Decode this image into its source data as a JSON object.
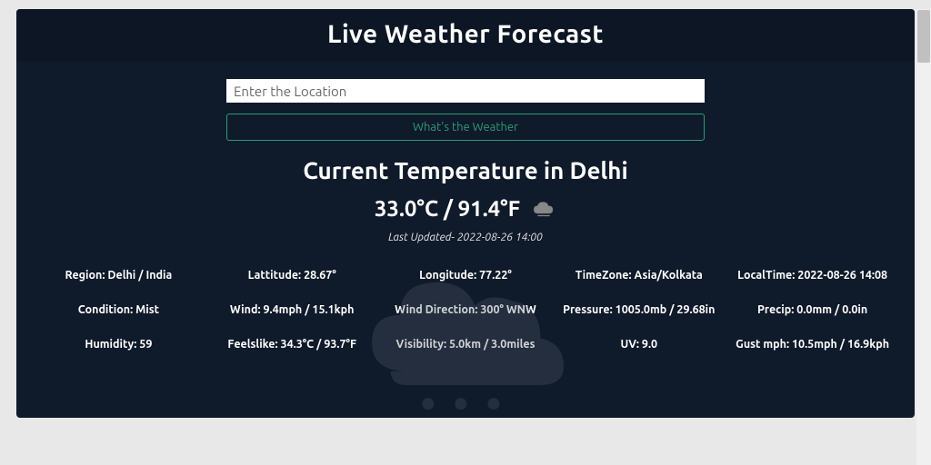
{
  "header": {
    "title": "Live Weather Forecast"
  },
  "search": {
    "placeholder": "Enter the Location",
    "button_label": "What's the Weather"
  },
  "current": {
    "heading": "Current Temperature in Delhi",
    "temp_display": "33.0°C / 91.4°F",
    "last_updated": "Last Updated- 2022-08-26 14:00"
  },
  "details": {
    "region": "Region: Delhi / India",
    "lattitude": "Lattitude: 28.67°",
    "longitude": "Longitude: 77.22°",
    "timezone": "TimeZone: Asia/Kolkata",
    "localtime": "LocalTime: 2022-08-26 14:08",
    "condition": "Condition: Mist",
    "wind": "Wind: 9.4mph / 15.1kph",
    "wind_direction": "Wind Direction: 300° WNW",
    "pressure": "Pressure: 1005.0mb / 29.68in",
    "precip": "Precip: 0.0mm / 0.0in",
    "humidity": "Humidity: 59",
    "feelslike": "Feelslike: 34.3°C / 93.7°F",
    "visibility": "Visibility: 5.0km / 3.0miles",
    "uv": "UV: 9.0",
    "gust": "Gust mph: 10.5mph / 16.9kph"
  }
}
